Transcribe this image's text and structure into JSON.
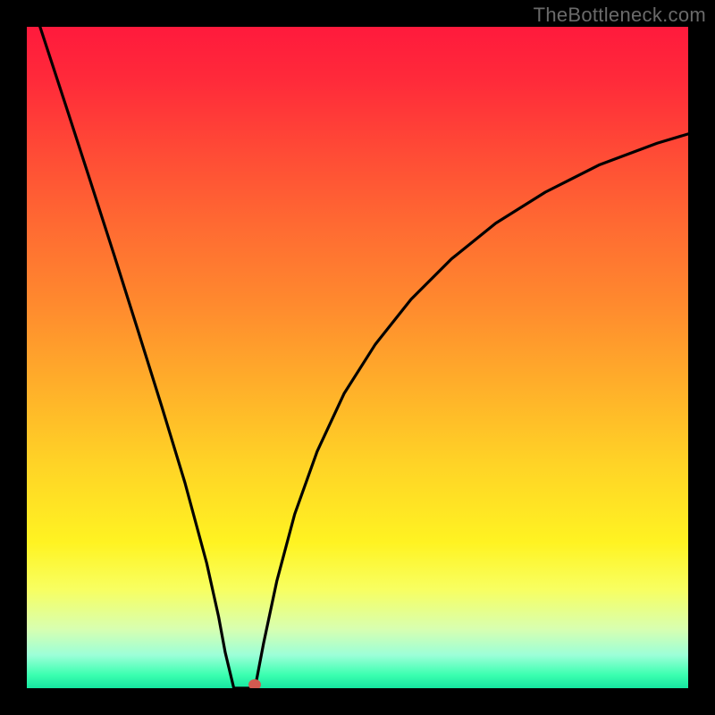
{
  "attribution": "TheBottleneck.com",
  "colors": {
    "frame_bg": "#000000",
    "curve_stroke": "#000000",
    "marker_fill": "#d25a50"
  },
  "chart_data": {
    "type": "line",
    "title": "",
    "xlabel": "",
    "ylabel": "",
    "xlim": [
      0,
      1
    ],
    "ylim": [
      0,
      1
    ],
    "series": [
      {
        "name": "left-branch",
        "x": [
          0.02,
          0.058,
          0.095,
          0.132,
          0.168,
          0.204,
          0.239,
          0.272,
          0.29,
          0.3,
          0.313
        ],
        "y": [
          1.0,
          0.884,
          0.77,
          0.655,
          0.541,
          0.426,
          0.311,
          0.189,
          0.108,
          0.054,
          0.0
        ]
      },
      {
        "name": "plateau",
        "x": [
          0.313,
          0.332,
          0.345
        ],
        "y": [
          0.0,
          0.0,
          0.0
        ]
      },
      {
        "name": "right-branch",
        "x": [
          0.345,
          0.358,
          0.378,
          0.405,
          0.439,
          0.48,
          0.527,
          0.581,
          0.642,
          0.709,
          0.784,
          0.865,
          0.953,
          1.0
        ],
        "y": [
          0.0,
          0.068,
          0.162,
          0.263,
          0.358,
          0.446,
          0.52,
          0.588,
          0.649,
          0.703,
          0.75,
          0.791,
          0.824,
          0.838
        ]
      }
    ],
    "marker": {
      "x": 0.345,
      "y": 0.0
    }
  }
}
